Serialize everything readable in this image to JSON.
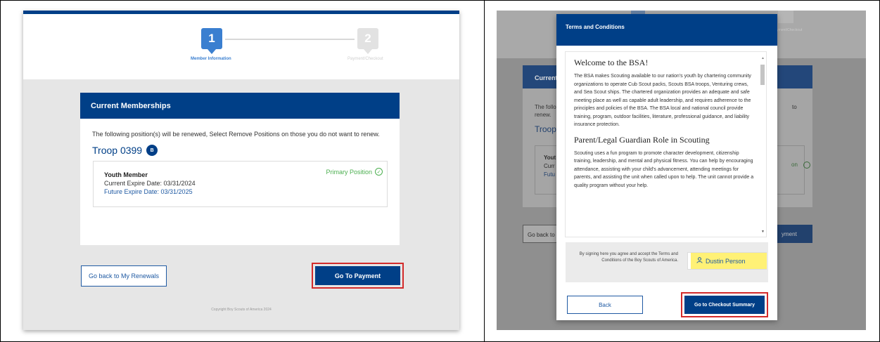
{
  "left": {
    "steps": [
      {
        "number": "1",
        "label": "Member Information"
      },
      {
        "number": "2",
        "label": "Payment/Checkout"
      }
    ],
    "card_title": "Current Memberships",
    "instruction": "The following position(s) will be renewed, Select Remove Positions on those you do not want to renew.",
    "troop": "Troop 0399",
    "troop_badge": "B",
    "member": {
      "title": "Youth Member",
      "current_expire": "Current Expire Date: 03/31/2024",
      "future_expire": "Future Expire Date: 03/31/2025",
      "primary": "Primary Position"
    },
    "back_button": "Go back to My Renewals",
    "payment_button": "Go To Payment",
    "copyright": "Copyright Boy Scouts of America 2024"
  },
  "right": {
    "background": {
      "step_label": "Payment/Checkout",
      "card_title": "Current",
      "text_1": "The follo",
      "text_2": "renew.",
      "text_right": "to",
      "troop": "Troop",
      "box_lines": [
        "Yout",
        "Curr",
        "Futu"
      ],
      "on_text": "on",
      "back_button": "Go back to",
      "payment_button": "yment"
    },
    "modal": {
      "title": "Terms and Conditions",
      "heading1": "Welcome to the BSA!",
      "paragraph1": "The BSA makes Scouting available to our nation's youth by chartering community organizations to operate Cub Scout packs, Scouts BSA troops, Venturing crews, and Sea Scout ships. The chartered organization provides an adequate and safe meeting place as well as capable adult leadership, and requires adherence to the principles and policies of the BSA. The BSA local and national council provide training, program, outdoor facilities, literature, professional guidance, and liability insurance protection.",
      "heading2": "Parent/Legal Guardian Role in Scouting",
      "paragraph2": "Scouting uses a fun program to promote character development, citizenship training, leadership, and mental and physical fitness. You can help by encouraging attendance, assisting with your child's advancement, attending meetings for parents, and assisting the unit when called upon to help. The unit cannot provide a quality program without your help.",
      "sign_text": "By signing here you agree and accept the Terms and Conditions of the Boy Scouts of America.",
      "signer_name": "Dustin Person",
      "back_button": "Back",
      "checkout_button": "Go to Checkout Summary"
    }
  },
  "colors": {
    "brand_blue": "#003f87",
    "link_blue": "#1f5aa3",
    "success_green": "#4caf50",
    "highlight_red": "#d32b2b",
    "signature_highlight": "#fff176"
  }
}
